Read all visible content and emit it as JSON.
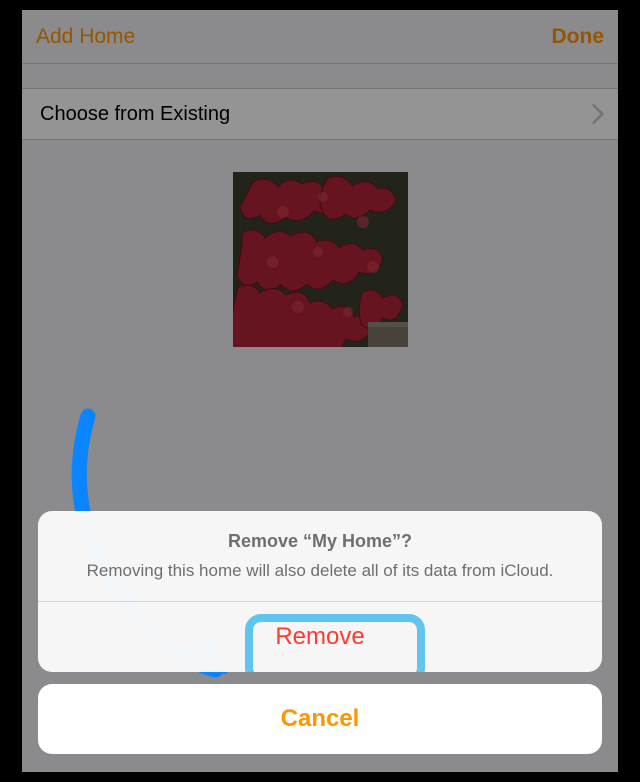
{
  "nav": {
    "title": "Add Home",
    "done": "Done"
  },
  "choose_row": {
    "label": "Choose from Existing"
  },
  "sheet": {
    "title": "Remove “My Home”?",
    "message": "Removing this home will also delete all of its data from iCloud.",
    "remove": "Remove",
    "cancel": "Cancel"
  },
  "colors": {
    "accent": "#ff9500",
    "destructive": "#ff3b30",
    "highlight": "#61c4ee"
  }
}
